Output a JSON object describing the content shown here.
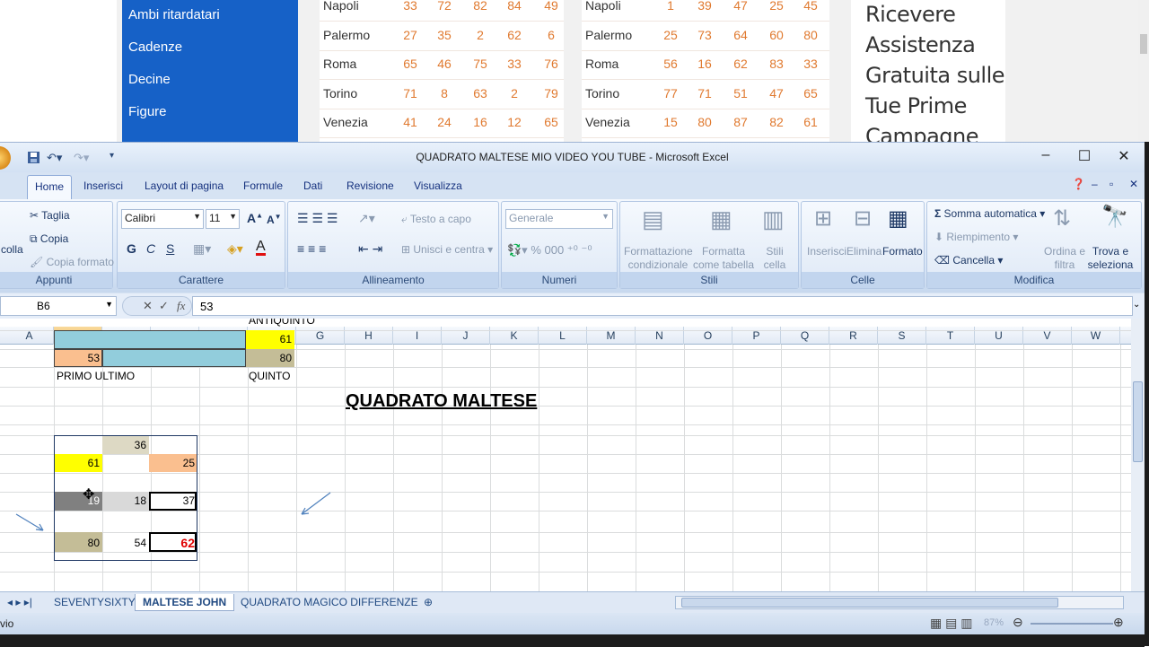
{
  "web": {
    "nav": [
      "Ambi ritardatari",
      "Cadenze",
      "Decine",
      "Figure"
    ],
    "table_left": [
      {
        "city": "Napoli",
        "nums": [
          "33",
          "72",
          "82",
          "84",
          "49"
        ]
      },
      {
        "city": "Palermo",
        "nums": [
          "27",
          "35",
          "2",
          "62",
          "6"
        ]
      },
      {
        "city": "Roma",
        "nums": [
          "65",
          "46",
          "75",
          "33",
          "76"
        ]
      },
      {
        "city": "Torino",
        "nums": [
          "71",
          "8",
          "63",
          "2",
          "79"
        ]
      },
      {
        "city": "Venezia",
        "nums": [
          "41",
          "24",
          "16",
          "12",
          "65"
        ]
      }
    ],
    "table_right": [
      {
        "city": "Napoli",
        "nums": [
          "1",
          "39",
          "47",
          "25",
          "45"
        ]
      },
      {
        "city": "Palermo",
        "nums": [
          "25",
          "73",
          "64",
          "60",
          "80"
        ]
      },
      {
        "city": "Roma",
        "nums": [
          "56",
          "16",
          "62",
          "83",
          "33"
        ]
      },
      {
        "city": "Torino",
        "nums": [
          "77",
          "71",
          "51",
          "47",
          "65"
        ]
      },
      {
        "city": "Venezia",
        "nums": [
          "15",
          "80",
          "87",
          "82",
          "61"
        ]
      }
    ],
    "ad_lines": [
      "Ricevere",
      "Assistenza",
      "Gratuita sulle",
      "Tue Prime",
      "Campagne"
    ]
  },
  "excel": {
    "title": "QUADRATO MALTESE MIO VIDEO YOU TUBE - Microsoft Excel",
    "tabs": [
      "Home",
      "Inserisci",
      "Layout di pagina",
      "Formule",
      "Dati",
      "Revisione",
      "Visualizza"
    ],
    "clipboard": {
      "cut": "Taglia",
      "copy": "Copia",
      "format_painter": "Copia formato",
      "paste": "colla",
      "label": "Appunti"
    },
    "font": {
      "name": "Calibri",
      "size": "11",
      "bold": "G",
      "italic": "C",
      "underline": "S",
      "label": "Carattere"
    },
    "alignment": {
      "wrap": "Testo a capo",
      "merge": "Unisci e centra",
      "label": "Allineamento"
    },
    "number": {
      "format": "Generale",
      "label": "Numeri"
    },
    "styles": {
      "cond": "Formattazione condizionale",
      "table": "Formatta come tabella",
      "cell": "Stili cella",
      "label": "Stili"
    },
    "cells": {
      "insert": "Inserisci",
      "delete": "Elimina",
      "format": "Formato",
      "label": "Celle"
    },
    "editing": {
      "autosum": "Somma automatica",
      "fill": "Riempimento",
      "clear": "Cancella",
      "sort": "Ordina e filtra",
      "find": "Trova e seleziona",
      "label": "Modifica"
    },
    "namebox": "B6",
    "formula": "53",
    "columns": [
      "A",
      "B",
      "C",
      "D",
      "E",
      "F",
      "G",
      "H",
      "I",
      "J",
      "K",
      "L",
      "M",
      "N",
      "O",
      "P",
      "Q",
      "R",
      "S",
      "T",
      "U",
      "V",
      "W"
    ],
    "cells_text": {
      "antiquinto": "ANTIQUINTO",
      "f5": "61",
      "b6": "53",
      "f6": "80",
      "primo": "PRIMO ULTIMO",
      "quinto": "QUINTO",
      "heading": "QUADRATO MALTESE",
      "c10": "36",
      "b11": "61",
      "d11": "25",
      "b13": "19",
      "c13": "18",
      "d13": "37",
      "b15": "80",
      "c15": "54",
      "d15": "62"
    },
    "sheets": [
      "SEVENTYSIXTY",
      "MALTESE JOHN",
      "QUADRATO MAGICO DIFFERENZE"
    ],
    "status": "vio",
    "zoom": "87%"
  }
}
